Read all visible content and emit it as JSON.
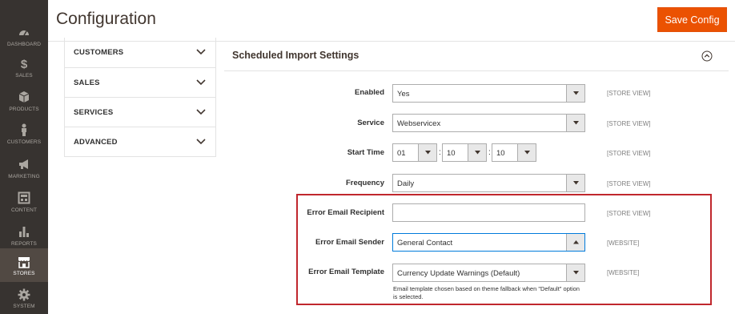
{
  "nav": {
    "items": [
      {
        "label": "DASHBOARD",
        "icon": "dashboard-icon",
        "active": false
      },
      {
        "label": "SALES",
        "icon": "dollar-icon",
        "active": false
      },
      {
        "label": "PRODUCTS",
        "icon": "cube-icon",
        "active": false
      },
      {
        "label": "CUSTOMERS",
        "icon": "person-icon",
        "active": false
      },
      {
        "label": "MARKETING",
        "icon": "megaphone-icon",
        "active": false
      },
      {
        "label": "CONTENT",
        "icon": "layout-icon",
        "active": false
      },
      {
        "label": "REPORTS",
        "icon": "bar-chart-icon",
        "active": false
      },
      {
        "label": "STORES",
        "icon": "store-icon",
        "active": true
      },
      {
        "label": "SYSTEM",
        "icon": "gear-icon",
        "active": false
      }
    ]
  },
  "header": {
    "title": "Configuration",
    "save_label": "Save Config"
  },
  "tabs": [
    {
      "label": "CUSTOMERS"
    },
    {
      "label": "SALES"
    },
    {
      "label": "SERVICES"
    },
    {
      "label": "ADVANCED"
    }
  ],
  "section": {
    "title": "Scheduled Import Settings"
  },
  "fields": {
    "enabled": {
      "label": "Enabled",
      "value": "Yes",
      "scope": "[STORE VIEW]"
    },
    "service": {
      "label": "Service",
      "value": "Webservicex",
      "scope": "[STORE VIEW]"
    },
    "start_time": {
      "label": "Start Time",
      "hour": "01",
      "minute": "10",
      "second": "10",
      "separator": ":",
      "scope": "[STORE VIEW]"
    },
    "frequency": {
      "label": "Frequency",
      "value": "Daily",
      "scope": "[STORE VIEW]"
    },
    "error_recipient": {
      "label": "Error Email Recipient",
      "value": "",
      "scope": "[STORE VIEW]"
    },
    "error_sender": {
      "label": "Error Email Sender",
      "value": "General Contact",
      "scope": "[WEBSITE]"
    },
    "error_template": {
      "label": "Error Email Template",
      "value": "Currency Update Warnings (Default)",
      "scope": "[WEBSITE]",
      "note": "Email template chosen based on theme fallback when \"Default\" option is selected."
    }
  },
  "colors": {
    "accent": "#eb5202",
    "highlight": "#c0272d",
    "nav_bg": "#373330",
    "nav_active": "#514943"
  }
}
